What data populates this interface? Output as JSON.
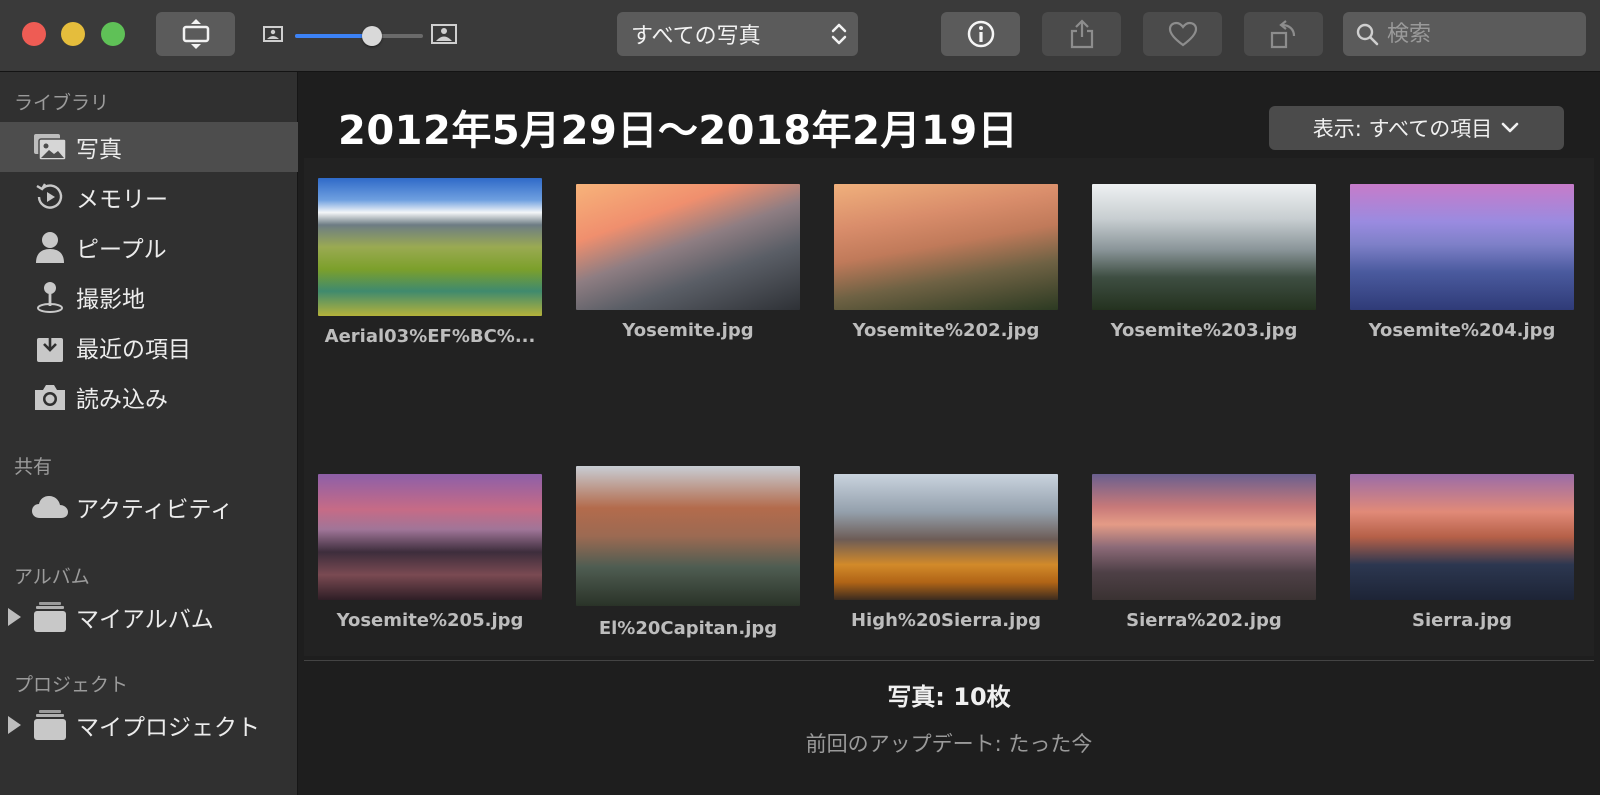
{
  "toolbar": {
    "view_select": "すべての写真",
    "search_placeholder": "検索",
    "thumbnail_size": 0.6
  },
  "sidebar": {
    "library_heading": "ライブラリ",
    "library_items": [
      {
        "label": "写真",
        "icon": "photos-icon",
        "selected": true
      },
      {
        "label": "メモリー",
        "icon": "memories-icon"
      },
      {
        "label": "ピープル",
        "icon": "people-icon"
      },
      {
        "label": "撮影地",
        "icon": "places-icon"
      },
      {
        "label": "最近の項目",
        "icon": "recents-icon"
      },
      {
        "label": "読み込み",
        "icon": "camera-icon"
      }
    ],
    "shared_heading": "共有",
    "shared_items": [
      {
        "label": "アクティビティ",
        "icon": "cloud-icon"
      }
    ],
    "albums_heading": "アルバム",
    "albums_items": [
      {
        "label": "マイアルバム",
        "icon": "album-stack-icon"
      }
    ],
    "projects_heading": "プロジェクト",
    "projects_items": [
      {
        "label": "マイプロジェクト",
        "icon": "album-stack-icon"
      }
    ]
  },
  "main": {
    "date_range": "2012年5月29日〜2018年2月19日",
    "show_label": "表示: すべての項目",
    "photos": [
      {
        "name": "Aerial03%EF%BC%..."
      },
      {
        "name": "Yosemite.jpg"
      },
      {
        "name": "Yosemite%202.jpg"
      },
      {
        "name": "Yosemite%203.jpg"
      },
      {
        "name": "Yosemite%204.jpg"
      },
      {
        "name": "Yosemite%205.jpg"
      },
      {
        "name": "El%20Capitan.jpg"
      },
      {
        "name": "High%20Sierra.jpg"
      },
      {
        "name": "Sierra%202.jpg"
      },
      {
        "name": "Sierra.jpg"
      }
    ],
    "count_label": "写真: 10枚",
    "updated_label": "前回のアップデート: たった今"
  }
}
